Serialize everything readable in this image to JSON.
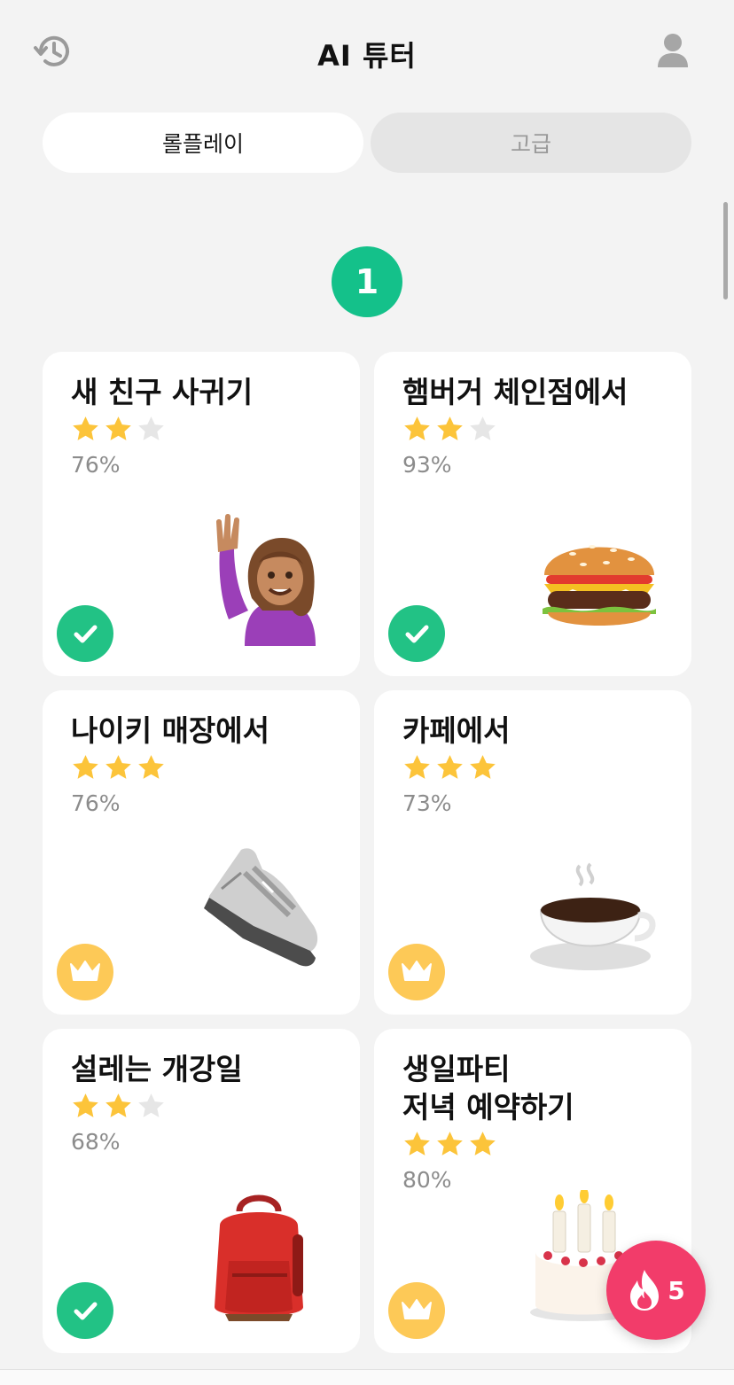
{
  "header": {
    "title": "AI 튜터",
    "history_icon": "history-icon",
    "profile_icon": "person-icon"
  },
  "tabs": [
    {
      "label": "롤플레이",
      "active": true
    },
    {
      "label": "고급",
      "active": false
    }
  ],
  "level": "1",
  "cards": [
    {
      "title": "새 친구 사귀기",
      "stars": 2,
      "max_stars": 3,
      "percent": "76%",
      "status": "completed",
      "illustration": "raising-hand-person"
    },
    {
      "title": "햄버거 체인점에서",
      "stars": 2,
      "max_stars": 3,
      "percent": "93%",
      "status": "completed",
      "illustration": "hamburger"
    },
    {
      "title": "나이키 매장에서",
      "stars": 3,
      "max_stars": 3,
      "percent": "76%",
      "status": "crown",
      "illustration": "sneaker"
    },
    {
      "title": "카페에서",
      "stars": 3,
      "max_stars": 3,
      "percent": "73%",
      "status": "crown",
      "illustration": "hot-coffee"
    },
    {
      "title": "설레는 개강일",
      "stars": 2,
      "max_stars": 3,
      "percent": "68%",
      "status": "completed",
      "illustration": "backpack"
    },
    {
      "title": "생일파티\n저녁 예약하기",
      "stars": 3,
      "max_stars": 3,
      "percent": "80%",
      "status": "crown",
      "illustration": "birthday-cake"
    }
  ],
  "streak": {
    "count": "5",
    "icon": "fire-icon"
  },
  "colors": {
    "accent_green": "#14c18a",
    "check_green": "#22c285",
    "star_gold": "#fcc43a",
    "star_empty": "#e6e6e6",
    "crown_yellow": "#fdc957",
    "fire_pink": "#f23c6a"
  }
}
